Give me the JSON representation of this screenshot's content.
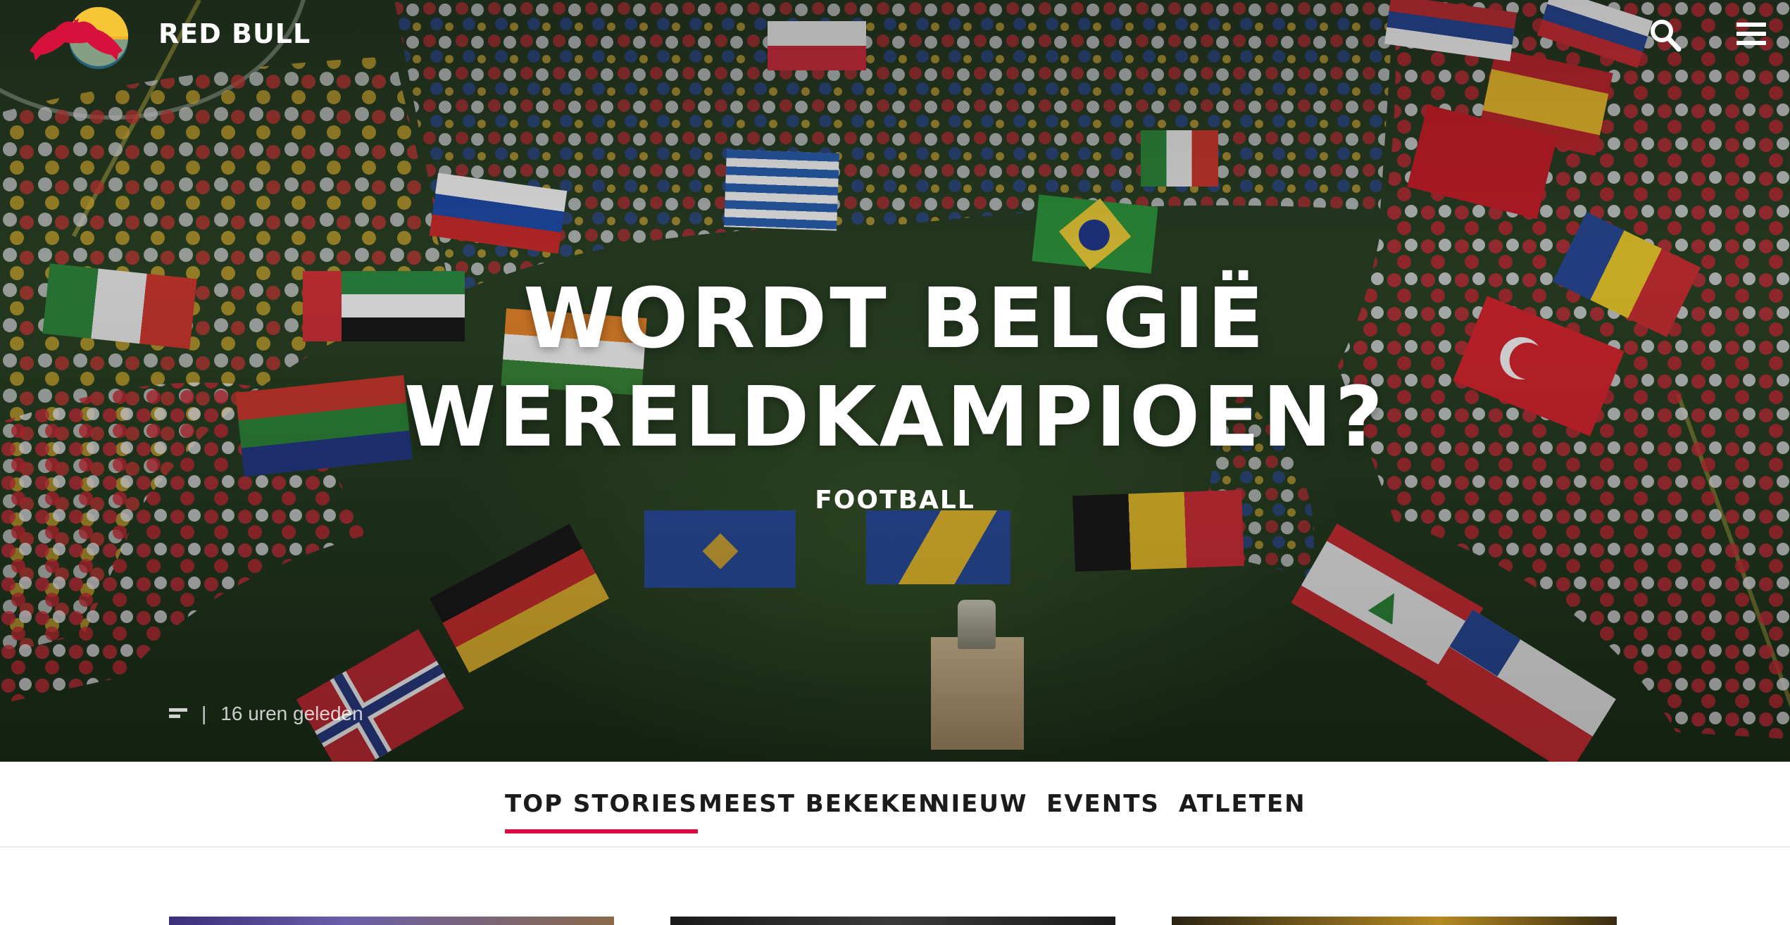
{
  "header": {
    "brand_name": "RED BULL",
    "logo_icon": "red-bull-logo-icon",
    "search_icon": "search-icon",
    "menu_icon": "hamburger-menu-icon"
  },
  "hero": {
    "headline_line1": "WORDT BELGIË",
    "headline_line2": "WERELDKAMPIOEN?",
    "category": "FOOTBALL",
    "separator": "|",
    "timestamp": "16 uren geleden",
    "article_icon": "article-icon"
  },
  "tabs": [
    {
      "label": "TOP STORIES",
      "active": true
    },
    {
      "label": "MEEST BEKEKEN",
      "active": false
    },
    {
      "label": "NIEUW",
      "active": false
    },
    {
      "label": "EVENTS",
      "active": false
    },
    {
      "label": "ATLETEN",
      "active": false
    }
  ],
  "colors": {
    "accent": "#db0a40",
    "text_dark": "#1b1b1b",
    "hero_text": "#ffffff"
  }
}
